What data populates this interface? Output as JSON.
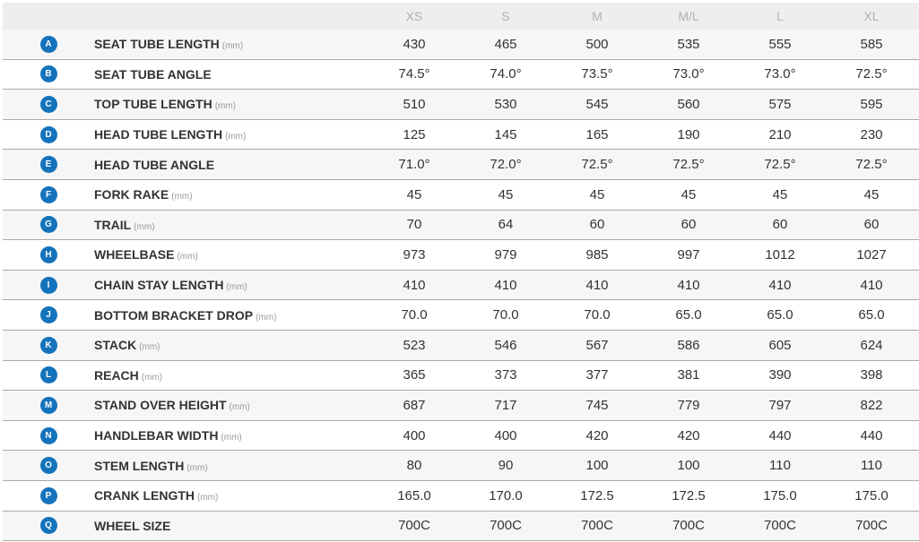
{
  "sizes": [
    "XS",
    "S",
    "M",
    "M/L",
    "L",
    "XL"
  ],
  "badge_color": "#1473bb",
  "rows": [
    {
      "letter": "A",
      "label": "SEAT TUBE LENGTH",
      "unit": "(mm)",
      "values": [
        "430",
        "465",
        "500",
        "535",
        "555",
        "585"
      ]
    },
    {
      "letter": "B",
      "label": "SEAT TUBE ANGLE",
      "unit": "",
      "values": [
        "74.5°",
        "74.0°",
        "73.5°",
        "73.0°",
        "73.0°",
        "72.5°"
      ]
    },
    {
      "letter": "C",
      "label": "TOP TUBE LENGTH",
      "unit": "(mm)",
      "values": [
        "510",
        "530",
        "545",
        "560",
        "575",
        "595"
      ]
    },
    {
      "letter": "D",
      "label": "HEAD TUBE LENGTH",
      "unit": "(mm)",
      "values": [
        "125",
        "145",
        "165",
        "190",
        "210",
        "230"
      ]
    },
    {
      "letter": "E",
      "label": "HEAD TUBE ANGLE",
      "unit": "",
      "values": [
        "71.0°",
        "72.0°",
        "72.5°",
        "72.5°",
        "72.5°",
        "72.5°"
      ]
    },
    {
      "letter": "F",
      "label": "FORK RAKE",
      "unit": "(mm)",
      "values": [
        "45",
        "45",
        "45",
        "45",
        "45",
        "45"
      ]
    },
    {
      "letter": "G",
      "label": "TRAIL",
      "unit": "(mm)",
      "values": [
        "70",
        "64",
        "60",
        "60",
        "60",
        "60"
      ]
    },
    {
      "letter": "H",
      "label": "WHEELBASE",
      "unit": "(mm)",
      "values": [
        "973",
        "979",
        "985",
        "997",
        "1012",
        "1027"
      ]
    },
    {
      "letter": "I",
      "label": "CHAIN STAY LENGTH",
      "unit": "(mm)",
      "values": [
        "410",
        "410",
        "410",
        "410",
        "410",
        "410"
      ]
    },
    {
      "letter": "J",
      "label": "BOTTOM BRACKET DROP",
      "unit": "(mm)",
      "values": [
        "70.0",
        "70.0",
        "70.0",
        "65.0",
        "65.0",
        "65.0"
      ]
    },
    {
      "letter": "K",
      "label": "STACK",
      "unit": "(mm)",
      "values": [
        "523",
        "546",
        "567",
        "586",
        "605",
        "624"
      ]
    },
    {
      "letter": "L",
      "label": "REACH",
      "unit": "(mm)",
      "values": [
        "365",
        "373",
        "377",
        "381",
        "390",
        "398"
      ]
    },
    {
      "letter": "M",
      "label": "STAND OVER HEIGHT",
      "unit": "(mm)",
      "values": [
        "687",
        "717",
        "745",
        "779",
        "797",
        "822"
      ]
    },
    {
      "letter": "N",
      "label": "HANDLEBAR WIDTH",
      "unit": "(mm)",
      "values": [
        "400",
        "400",
        "420",
        "420",
        "440",
        "440"
      ]
    },
    {
      "letter": "O",
      "label": "STEM LENGTH",
      "unit": "(mm)",
      "values": [
        "80",
        "90",
        "100",
        "100",
        "110",
        "110"
      ]
    },
    {
      "letter": "P",
      "label": "CRANK LENGTH",
      "unit": "(mm)",
      "values": [
        "165.0",
        "170.0",
        "172.5",
        "172.5",
        "175.0",
        "175.0"
      ]
    },
    {
      "letter": "Q",
      "label": "WHEEL SIZE",
      "unit": "",
      "values": [
        "700C",
        "700C",
        "700C",
        "700C",
        "700C",
        "700C"
      ]
    }
  ]
}
